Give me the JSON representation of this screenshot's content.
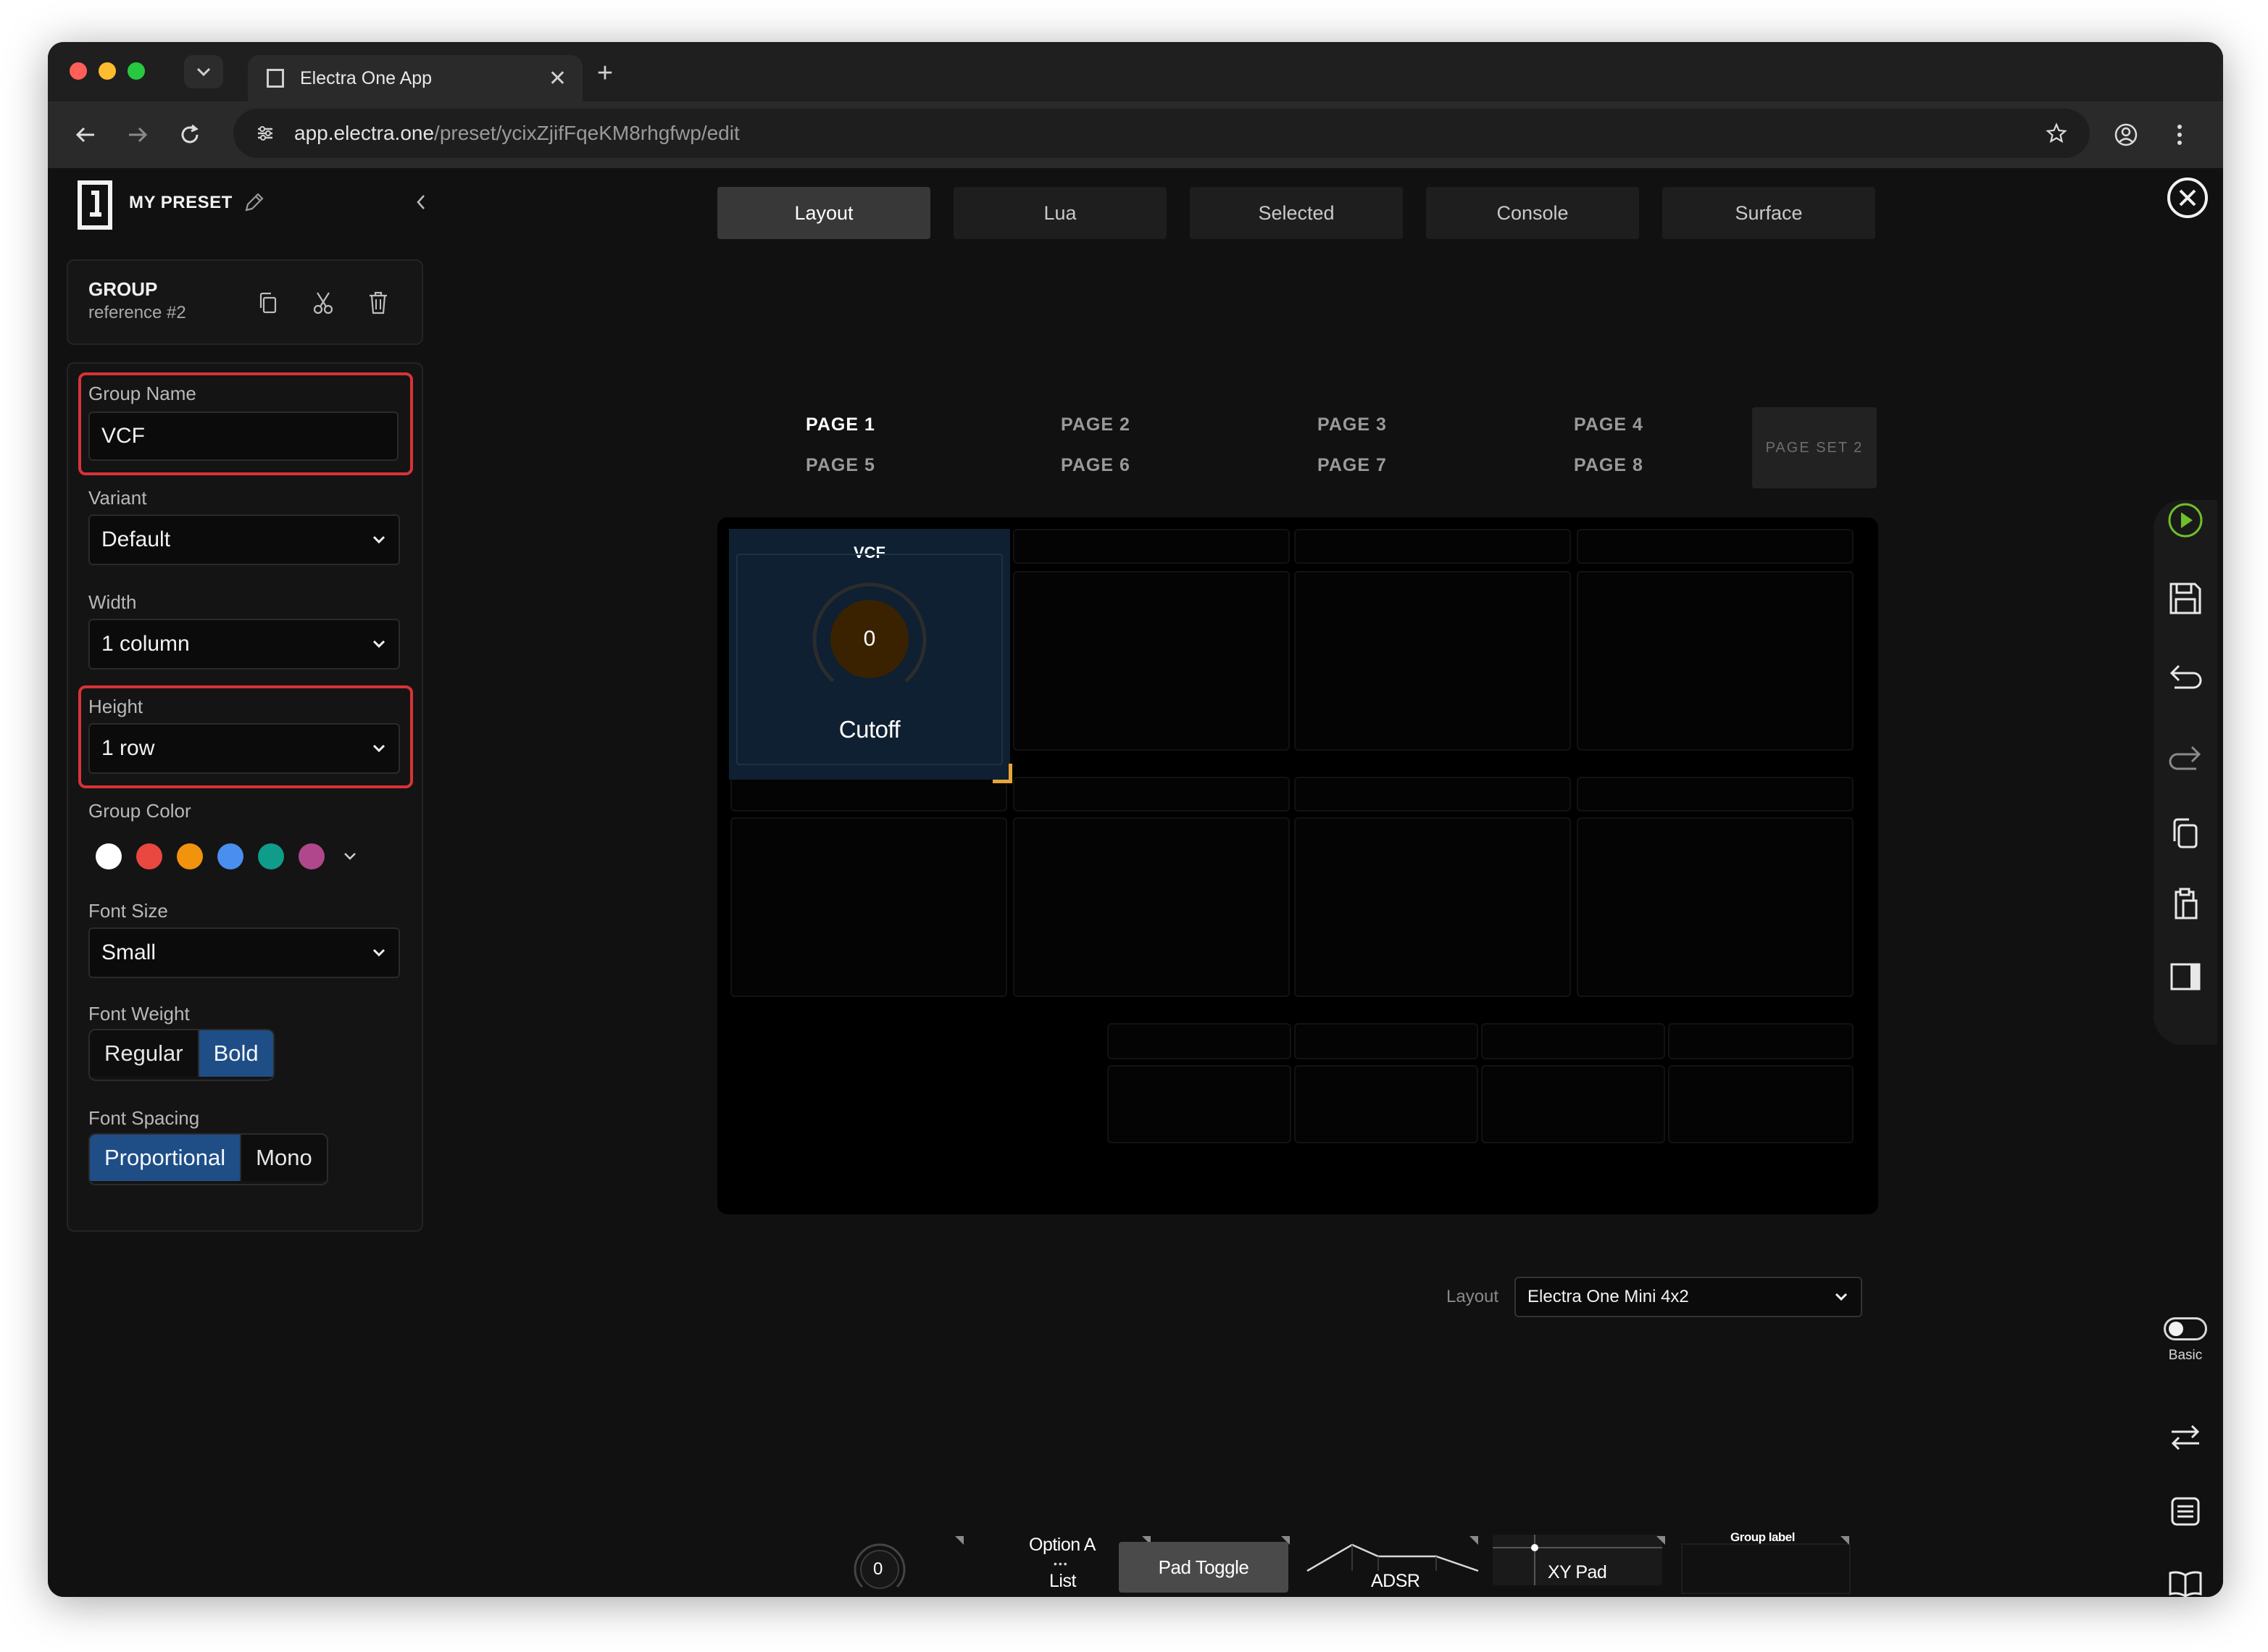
{
  "browser": {
    "tab_title": "Electra One App",
    "url_host": "app.electra.one",
    "url_path": "/preset/ycixZjifFqeKM8rhgfwp/edit"
  },
  "preset": {
    "title": "MY PRESET"
  },
  "group_card": {
    "heading": "GROUP",
    "subtitle": "reference #2"
  },
  "properties": {
    "group_name_label": "Group Name",
    "group_name_value": "VCF",
    "variant_label": "Variant",
    "variant_value": "Default",
    "width_label": "Width",
    "width_value": "1 column",
    "height_label": "Height",
    "height_value": "1 row",
    "group_color_label": "Group Color",
    "group_colors": [
      "#ffffff",
      "#e8483f",
      "#f2930d",
      "#4a8ef0",
      "#0f9c8a",
      "#b0478c"
    ],
    "font_size_label": "Font Size",
    "font_size_value": "Small",
    "font_weight_label": "Font Weight",
    "font_weight_options": [
      "Regular",
      "Bold"
    ],
    "font_weight_selected": "Bold",
    "font_spacing_label": "Font Spacing",
    "font_spacing_options": [
      "Proportional",
      "Mono"
    ],
    "font_spacing_selected": "Proportional"
  },
  "mode_tabs": [
    "Layout",
    "Lua",
    "Selected",
    "Console",
    "Surface"
  ],
  "mode_tab_active": "Layout",
  "pages": [
    "PAGE 1",
    "PAGE 2",
    "PAGE 3",
    "PAGE 4",
    "PAGE 5",
    "PAGE 6",
    "PAGE 7",
    "PAGE 8"
  ],
  "page_active": "PAGE 1",
  "page_set": "PAGE SET 2",
  "selected_control": {
    "group_title": "VCF",
    "value": "0",
    "label": "Cutoff"
  },
  "layout_selector": {
    "label": "Layout",
    "value": "Electra One Mini 4x2"
  },
  "mode_toggle_label": "Basic",
  "palette": {
    "knob_value": "0",
    "list_option": "Option A",
    "list_label": "List",
    "pad_toggle": "Pad Toggle",
    "adsr": "ADSR",
    "xy_pad": "XY Pad",
    "group_label": "Group label"
  },
  "colors": {
    "accent_blue": "#1f4e86",
    "highlight_red": "#d93238",
    "handle_orange": "#e8a53a",
    "play_green": "#6fbf2a"
  }
}
